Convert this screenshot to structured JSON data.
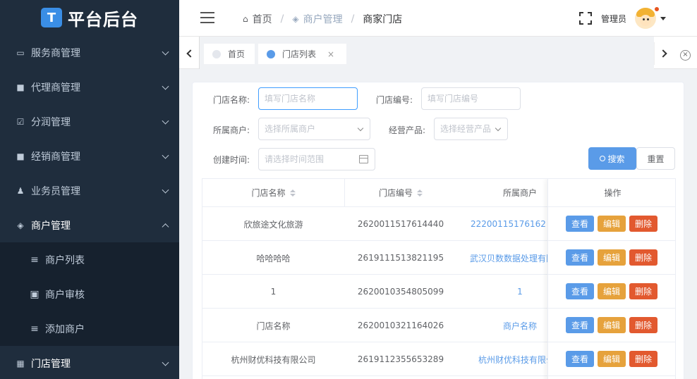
{
  "app": {
    "logo_letter": "T",
    "title": "平台后台"
  },
  "sidebar": {
    "items": [
      {
        "label": "服务商管理",
        "icon": "card-icon"
      },
      {
        "label": "代理商管理",
        "icon": "doc-icon"
      },
      {
        "label": "分润管理",
        "icon": "check-square-icon"
      },
      {
        "label": "经销商管理",
        "icon": "copy-icon"
      },
      {
        "label": "业务员管理",
        "icon": "user-icon"
      },
      {
        "label": "商户管理",
        "icon": "layers-icon"
      }
    ],
    "sub_items": [
      {
        "label": "商户列表",
        "icon": "list-icon"
      },
      {
        "label": "商户审核",
        "icon": "clipboard-icon"
      },
      {
        "label": "添加商户",
        "icon": "list-icon"
      }
    ],
    "last_item": {
      "label": "门店管理",
      "icon": "grid-icon"
    }
  },
  "header": {
    "breadcrumb": [
      "首页",
      "商户管理",
      "商家门店"
    ],
    "username": "管理员"
  },
  "tags": [
    {
      "label": "首页"
    },
    {
      "label": "门店列表",
      "close": "×"
    }
  ],
  "filters": {
    "store_name_label": "门店名称:",
    "store_name_placeholder": "填写门店名称",
    "store_no_label": "门店编号:",
    "store_no_placeholder": "填写门店编号",
    "merchant_label": "所属商户:",
    "merchant_placeholder": "选择所属商户",
    "product_label": "经营产品:",
    "product_placeholder": "选择经营产品",
    "time_label": "创建时间:",
    "time_placeholder": "请选择时间范围",
    "search_label": "搜索",
    "reset_label": "重置"
  },
  "table": {
    "headers": {
      "name": "门店名称",
      "no": "门店编号",
      "merchant": "所属商户",
      "ops": "操作"
    },
    "op_labels": {
      "view": "查看",
      "edit": "编辑",
      "delete": "删除"
    },
    "rows": [
      {
        "name": "欣旅途文化旅游",
        "no": "2620011517614440",
        "merchant": "22200115176162"
      },
      {
        "name": "哈哈哈哈",
        "no": "2619111513821195",
        "merchant": "武汉贝数数据处理有限"
      },
      {
        "name": "1",
        "no": "2620010354805099",
        "merchant": "1"
      },
      {
        "name": "门店名称",
        "no": "2620010321164026",
        "merchant": "商户名称"
      },
      {
        "name": "杭州财优科技有限公司",
        "no": "2619112355653289",
        "merchant": "杭州财优科技有限公"
      }
    ]
  },
  "colors": {
    "sidebar_bg": "#1f2d3d",
    "primary": "#5a9be8",
    "warning": "#e6a23c",
    "danger": "#e2592f"
  }
}
